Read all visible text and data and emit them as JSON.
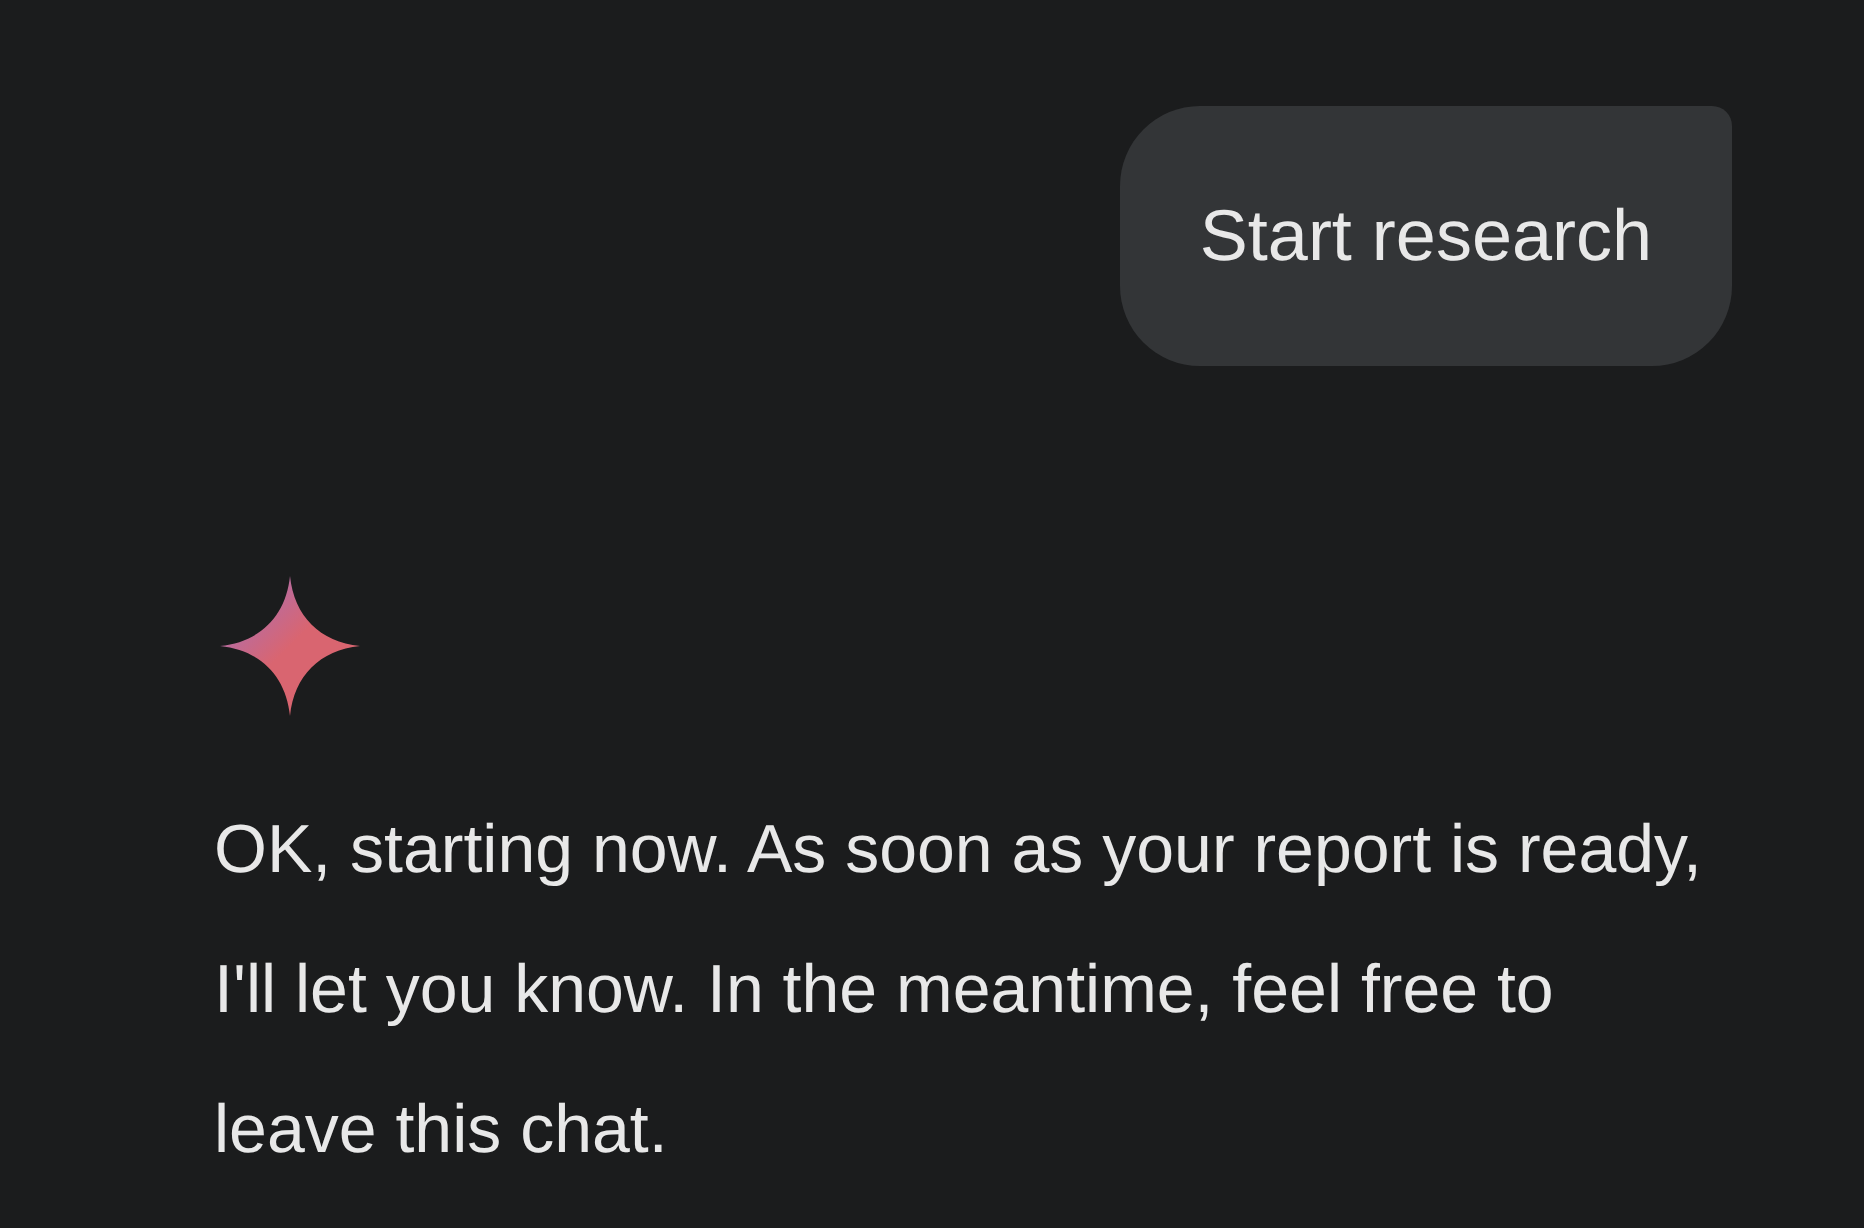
{
  "messages": [
    {
      "kind": "user",
      "text": "Start research"
    },
    {
      "kind": "assistant",
      "text": "OK, starting now. As soon as your report is ready, I'll let you know. In the meantime, feel free to leave this chat."
    }
  ]
}
